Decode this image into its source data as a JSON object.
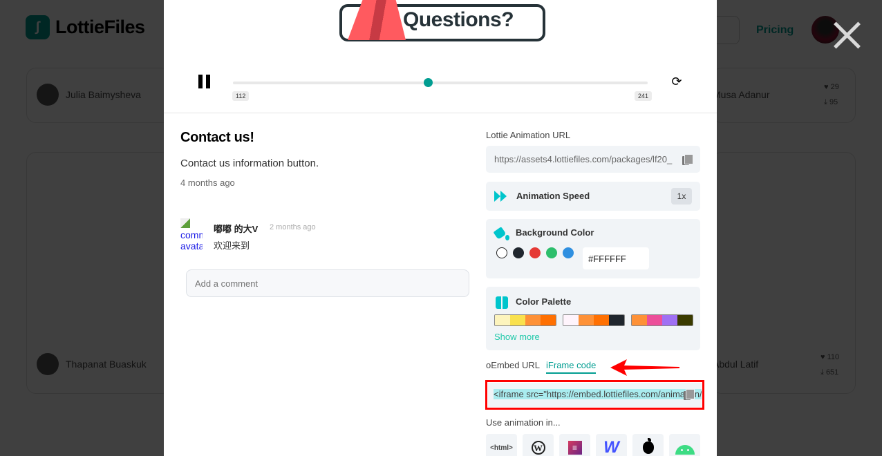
{
  "background": {
    "brand": "LottieFiles",
    "nav_pricing": "Pricing",
    "cards": [
      {
        "author": "Julia Baimysheva"
      },
      {
        "author": "Musa Adanur",
        "likes": "29",
        "downloads": "95"
      },
      {
        "author": "Thapanat Buaskuk"
      },
      {
        "author": "Abdul Latif",
        "likes": "110",
        "downloads": "651"
      }
    ]
  },
  "modal": {
    "animation_text": "Questions?",
    "player": {
      "start_frame": "112",
      "end_frame": "241",
      "progress": 0.47
    },
    "title": "Contact us!",
    "description": "Contact us information button.",
    "date": "4 months ago",
    "comment": {
      "avatar_alt": "comment avatar",
      "user": "嘟嘟 的大V",
      "time": "2 months ago",
      "text": "欢迎来到"
    },
    "comment_input_placeholder": "Add a comment",
    "lottie_url_label": "Lottie Animation URL",
    "lottie_url": "https://assets4.lottiefiles.com/packages/lf20_",
    "speed": {
      "label": "Animation Speed",
      "value": "1x"
    },
    "background_color": {
      "label": "Background Color",
      "swatches": [
        "#FFFFFF",
        "#20262E",
        "#E53935",
        "#2DBE6C",
        "#2F8FE0"
      ],
      "value": "#FFFFFF"
    },
    "color_palette": {
      "label": "Color Palette",
      "palettes": [
        [
          "#FDF4BD",
          "#F9E14E",
          "#FE9137",
          "#FF7002"
        ],
        [
          "#FFF4FC",
          "#FE9137",
          "#FF7002",
          "#20262E"
        ],
        [
          "#FE9137",
          "#EC4F9A",
          "#A070F3",
          "#3B3B00"
        ]
      ],
      "show_more": "Show more"
    },
    "embed_tabs": [
      "oEmbed URL",
      "iFrame code"
    ],
    "active_embed_tab": "iFrame code",
    "iframe_code": "<iframe src=\"https://embed.lottiefiles.com/animation/",
    "use_in_label": "Use animation in...",
    "platforms": [
      "<html>",
      "WordPress",
      "Elementor",
      "Webflow",
      "iOS",
      "Android"
    ],
    "accent": "#019D91",
    "highlight_border": "#FF0000"
  }
}
